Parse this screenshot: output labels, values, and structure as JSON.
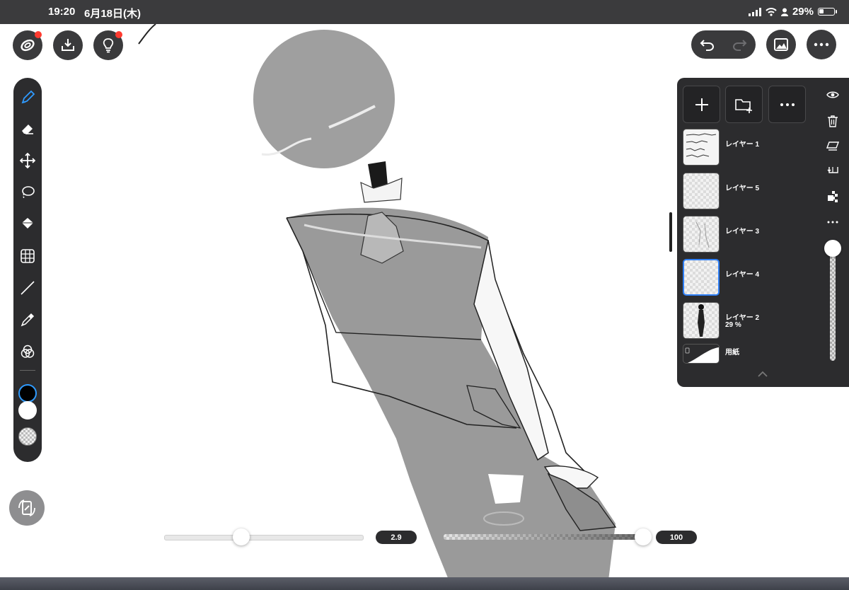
{
  "status_bar": {
    "time": "19:20",
    "date": "6月18日(木)",
    "battery_percent": "29%",
    "battery_level": 0.29
  },
  "top_left_buttons": [
    {
      "icon": "app-logo-icon",
      "badge": true
    },
    {
      "icon": "download-icon",
      "badge": false
    },
    {
      "icon": "lightbulb-icon",
      "badge": true
    }
  ],
  "top_right_buttons": [
    "undo-icon",
    "redo-icon",
    "gallery-icon",
    "more-icon"
  ],
  "tools": [
    {
      "name": "pen-icon",
      "active": true
    },
    {
      "name": "eraser-icon",
      "active": false
    },
    {
      "name": "move-icon",
      "active": false
    },
    {
      "name": "lasso-icon",
      "active": false
    },
    {
      "name": "fill-bucket-icon",
      "active": false
    },
    {
      "name": "grid-transform-icon",
      "active": false
    },
    {
      "name": "line-icon",
      "active": false
    },
    {
      "name": "eyedropper-icon",
      "active": false
    },
    {
      "name": "color-blend-icon",
      "active": false
    }
  ],
  "colors": {
    "primary": "#000000",
    "secondary": "#ffffff",
    "accent": "#2f7ff5",
    "panel": "#2c2c2e"
  },
  "brush_size": {
    "value": "2.9",
    "fraction": 0.39
  },
  "brush_opacity": {
    "value": "100",
    "fraction": 1.0
  },
  "layer_panel": {
    "actions": [
      "add-layer-icon",
      "add-folder-icon",
      "more-icon"
    ],
    "layers": [
      {
        "name": "レイヤー 1",
        "opacity": "",
        "selected": false,
        "thumbnail": "handwritten-text"
      },
      {
        "name": "レイヤー 5",
        "opacity": "",
        "selected": false,
        "thumbnail": "empty"
      },
      {
        "name": "レイヤー 3",
        "opacity": "",
        "selected": false,
        "thumbnail": "sketch"
      },
      {
        "name": "レイヤー 4",
        "opacity": "",
        "selected": true,
        "thumbnail": "empty"
      },
      {
        "name": "レイヤー 2",
        "opacity": "29 %",
        "selected": false,
        "thumbnail": "figure"
      },
      {
        "name": "用紙",
        "opacity": "",
        "selected": false,
        "thumbnail": "paper"
      }
    ],
    "side_icons": [
      "eye-icon",
      "trash-icon",
      "clear-layer-icon",
      "merge-down-icon",
      "transparency-lock-icon",
      "more-icon"
    ],
    "layer_opacity_fraction": 1.0
  }
}
